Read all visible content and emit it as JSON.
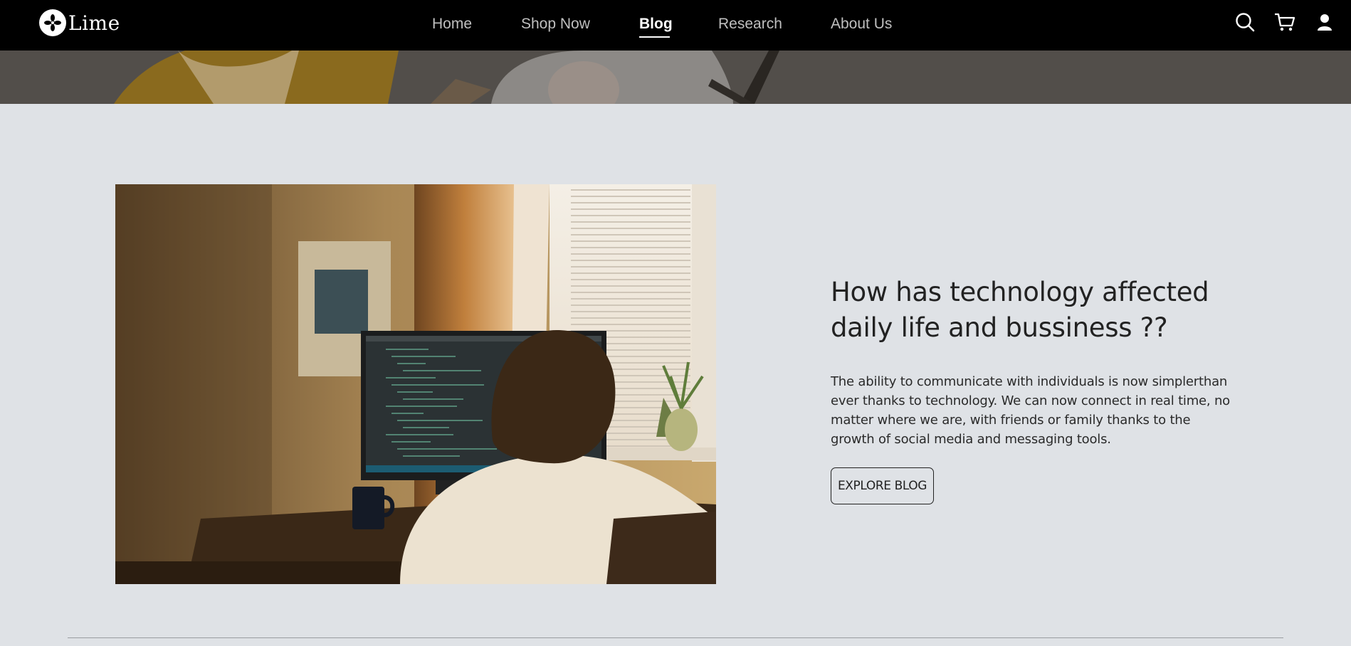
{
  "brand": {
    "name": "Lime",
    "logo_icon": "lime-flower-logo"
  },
  "nav": {
    "links": [
      {
        "label": "Home",
        "active": false
      },
      {
        "label": "Shop Now",
        "active": false
      },
      {
        "label": "Blog",
        "active": true
      },
      {
        "label": "Research",
        "active": false
      },
      {
        "label": "About Us",
        "active": false
      }
    ],
    "icons": [
      "search-icon",
      "cart-icon",
      "user-icon"
    ]
  },
  "feature": {
    "title_line1": "How has technology affected",
    "title_line2": "daily life and bussiness ??",
    "body": "The ability to communicate with individuals is now simplerthan ever thanks to technology. We can now connect in real time, no matter where we are, with friends or family thanks to the growth of social media and messaging tools.",
    "button_label": "EXPLORE BLOG"
  },
  "colors": {
    "nav_bg": "#000000",
    "page_bg": "#dfe2e6",
    "nav_text": "#bfbfbf",
    "nav_active": "#ffffff",
    "text": "#222222"
  }
}
